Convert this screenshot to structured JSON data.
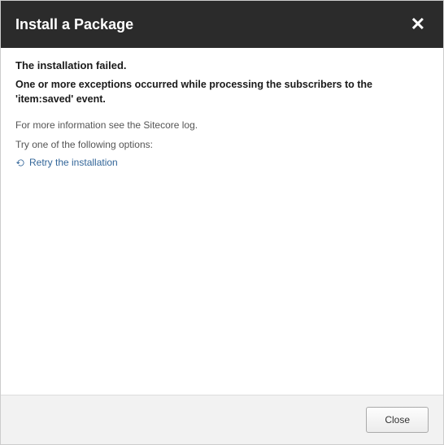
{
  "header": {
    "title": "Install a Package"
  },
  "body": {
    "error_heading": "The installation failed.",
    "error_message": "One or more exceptions occurred while processing the subscribers to the 'item:saved' event.",
    "info_line": "For more information see the Sitecore log.",
    "options_line": "Try one of the following options:",
    "retry_label": "Retry the installation"
  },
  "footer": {
    "close_label": "Close"
  }
}
